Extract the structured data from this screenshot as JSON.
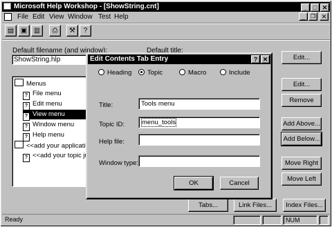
{
  "window": {
    "title": "Microsoft Help Workshop - [ShowString.cnt]"
  },
  "menu": {
    "file": "File",
    "edit": "Edit",
    "view": "View",
    "window": "Window",
    "test": "Test",
    "help": "Help"
  },
  "main": {
    "default_filename_label": "Default filename (and window):",
    "default_filename_value": "ShowString.hlp",
    "default_title_label": "Default title:"
  },
  "tree": {
    "items": [
      {
        "label": "Menus"
      },
      {
        "label": "File menu"
      },
      {
        "label": "Edit menu"
      },
      {
        "label": "View menu"
      },
      {
        "label": "Window menu"
      },
      {
        "label": "Help menu"
      },
      {
        "label": "<<add your application>>"
      },
      {
        "label": "<<add your topic jumps>>"
      }
    ]
  },
  "buttons": {
    "edit_top": "Edit...",
    "edit": "Edit...",
    "remove": "Remove",
    "add_above": "Add Above...",
    "add_below": "Add Below...",
    "move_right": "Move Right",
    "move_left": "Move Left",
    "tabs": "Tabs...",
    "link_files": "Link Files...",
    "index_files": "Index Files..."
  },
  "dialog": {
    "title": "Edit Contents Tab Entry",
    "radio_heading": "Heading",
    "radio_topic": "Topic",
    "radio_macro": "Macro",
    "radio_include": "Include",
    "title_label": "Title:",
    "title_value": "Tools menu",
    "topic_id_label": "Topic ID:",
    "topic_id_value": "menu_tools",
    "help_file_label": "Help file:",
    "help_file_value": "",
    "window_type_label": "Window type:",
    "window_type_value": "",
    "ok": "OK",
    "cancel": "Cancel"
  },
  "status": {
    "text": "Ready",
    "num": "NUM"
  },
  "icons": [
    "help-book-icon",
    "new-icon",
    "save-icon",
    "delete-icon",
    "print-icon",
    "compile-icon",
    "help-icon"
  ],
  "colors": {
    "face": "#c0c0c0",
    "titlebar": "#000000",
    "highlight": "#000000"
  }
}
